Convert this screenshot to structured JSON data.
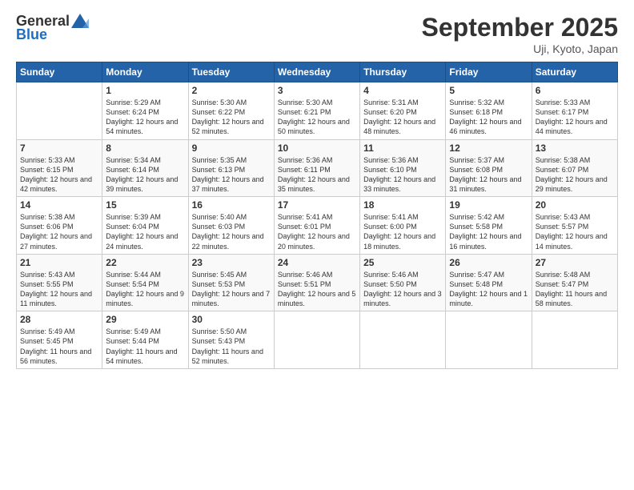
{
  "header": {
    "logo_general": "General",
    "logo_blue": "Blue",
    "month_title": "September 2025",
    "location": "Uji, Kyoto, Japan"
  },
  "weekdays": [
    "Sunday",
    "Monday",
    "Tuesday",
    "Wednesday",
    "Thursday",
    "Friday",
    "Saturday"
  ],
  "weeks": [
    [
      {
        "day": "",
        "sunrise": "",
        "sunset": "",
        "daylight": ""
      },
      {
        "day": "1",
        "sunrise": "Sunrise: 5:29 AM",
        "sunset": "Sunset: 6:24 PM",
        "daylight": "Daylight: 12 hours and 54 minutes."
      },
      {
        "day": "2",
        "sunrise": "Sunrise: 5:30 AM",
        "sunset": "Sunset: 6:22 PM",
        "daylight": "Daylight: 12 hours and 52 minutes."
      },
      {
        "day": "3",
        "sunrise": "Sunrise: 5:30 AM",
        "sunset": "Sunset: 6:21 PM",
        "daylight": "Daylight: 12 hours and 50 minutes."
      },
      {
        "day": "4",
        "sunrise": "Sunrise: 5:31 AM",
        "sunset": "Sunset: 6:20 PM",
        "daylight": "Daylight: 12 hours and 48 minutes."
      },
      {
        "day": "5",
        "sunrise": "Sunrise: 5:32 AM",
        "sunset": "Sunset: 6:18 PM",
        "daylight": "Daylight: 12 hours and 46 minutes."
      },
      {
        "day": "6",
        "sunrise": "Sunrise: 5:33 AM",
        "sunset": "Sunset: 6:17 PM",
        "daylight": "Daylight: 12 hours and 44 minutes."
      }
    ],
    [
      {
        "day": "7",
        "sunrise": "Sunrise: 5:33 AM",
        "sunset": "Sunset: 6:15 PM",
        "daylight": "Daylight: 12 hours and 42 minutes."
      },
      {
        "day": "8",
        "sunrise": "Sunrise: 5:34 AM",
        "sunset": "Sunset: 6:14 PM",
        "daylight": "Daylight: 12 hours and 39 minutes."
      },
      {
        "day": "9",
        "sunrise": "Sunrise: 5:35 AM",
        "sunset": "Sunset: 6:13 PM",
        "daylight": "Daylight: 12 hours and 37 minutes."
      },
      {
        "day": "10",
        "sunrise": "Sunrise: 5:36 AM",
        "sunset": "Sunset: 6:11 PM",
        "daylight": "Daylight: 12 hours and 35 minutes."
      },
      {
        "day": "11",
        "sunrise": "Sunrise: 5:36 AM",
        "sunset": "Sunset: 6:10 PM",
        "daylight": "Daylight: 12 hours and 33 minutes."
      },
      {
        "day": "12",
        "sunrise": "Sunrise: 5:37 AM",
        "sunset": "Sunset: 6:08 PM",
        "daylight": "Daylight: 12 hours and 31 minutes."
      },
      {
        "day": "13",
        "sunrise": "Sunrise: 5:38 AM",
        "sunset": "Sunset: 6:07 PM",
        "daylight": "Daylight: 12 hours and 29 minutes."
      }
    ],
    [
      {
        "day": "14",
        "sunrise": "Sunrise: 5:38 AM",
        "sunset": "Sunset: 6:06 PM",
        "daylight": "Daylight: 12 hours and 27 minutes."
      },
      {
        "day": "15",
        "sunrise": "Sunrise: 5:39 AM",
        "sunset": "Sunset: 6:04 PM",
        "daylight": "Daylight: 12 hours and 24 minutes."
      },
      {
        "day": "16",
        "sunrise": "Sunrise: 5:40 AM",
        "sunset": "Sunset: 6:03 PM",
        "daylight": "Daylight: 12 hours and 22 minutes."
      },
      {
        "day": "17",
        "sunrise": "Sunrise: 5:41 AM",
        "sunset": "Sunset: 6:01 PM",
        "daylight": "Daylight: 12 hours and 20 minutes."
      },
      {
        "day": "18",
        "sunrise": "Sunrise: 5:41 AM",
        "sunset": "Sunset: 6:00 PM",
        "daylight": "Daylight: 12 hours and 18 minutes."
      },
      {
        "day": "19",
        "sunrise": "Sunrise: 5:42 AM",
        "sunset": "Sunset: 5:58 PM",
        "daylight": "Daylight: 12 hours and 16 minutes."
      },
      {
        "day": "20",
        "sunrise": "Sunrise: 5:43 AM",
        "sunset": "Sunset: 5:57 PM",
        "daylight": "Daylight: 12 hours and 14 minutes."
      }
    ],
    [
      {
        "day": "21",
        "sunrise": "Sunrise: 5:43 AM",
        "sunset": "Sunset: 5:55 PM",
        "daylight": "Daylight: 12 hours and 11 minutes."
      },
      {
        "day": "22",
        "sunrise": "Sunrise: 5:44 AM",
        "sunset": "Sunset: 5:54 PM",
        "daylight": "Daylight: 12 hours and 9 minutes."
      },
      {
        "day": "23",
        "sunrise": "Sunrise: 5:45 AM",
        "sunset": "Sunset: 5:53 PM",
        "daylight": "Daylight: 12 hours and 7 minutes."
      },
      {
        "day": "24",
        "sunrise": "Sunrise: 5:46 AM",
        "sunset": "Sunset: 5:51 PM",
        "daylight": "Daylight: 12 hours and 5 minutes."
      },
      {
        "day": "25",
        "sunrise": "Sunrise: 5:46 AM",
        "sunset": "Sunset: 5:50 PM",
        "daylight": "Daylight: 12 hours and 3 minutes."
      },
      {
        "day": "26",
        "sunrise": "Sunrise: 5:47 AM",
        "sunset": "Sunset: 5:48 PM",
        "daylight": "Daylight: 12 hours and 1 minute."
      },
      {
        "day": "27",
        "sunrise": "Sunrise: 5:48 AM",
        "sunset": "Sunset: 5:47 PM",
        "daylight": "Daylight: 11 hours and 58 minutes."
      }
    ],
    [
      {
        "day": "28",
        "sunrise": "Sunrise: 5:49 AM",
        "sunset": "Sunset: 5:45 PM",
        "daylight": "Daylight: 11 hours and 56 minutes."
      },
      {
        "day": "29",
        "sunrise": "Sunrise: 5:49 AM",
        "sunset": "Sunset: 5:44 PM",
        "daylight": "Daylight: 11 hours and 54 minutes."
      },
      {
        "day": "30",
        "sunrise": "Sunrise: 5:50 AM",
        "sunset": "Sunset: 5:43 PM",
        "daylight": "Daylight: 11 hours and 52 minutes."
      },
      {
        "day": "",
        "sunrise": "",
        "sunset": "",
        "daylight": ""
      },
      {
        "day": "",
        "sunrise": "",
        "sunset": "",
        "daylight": ""
      },
      {
        "day": "",
        "sunrise": "",
        "sunset": "",
        "daylight": ""
      },
      {
        "day": "",
        "sunrise": "",
        "sunset": "",
        "daylight": ""
      }
    ]
  ]
}
